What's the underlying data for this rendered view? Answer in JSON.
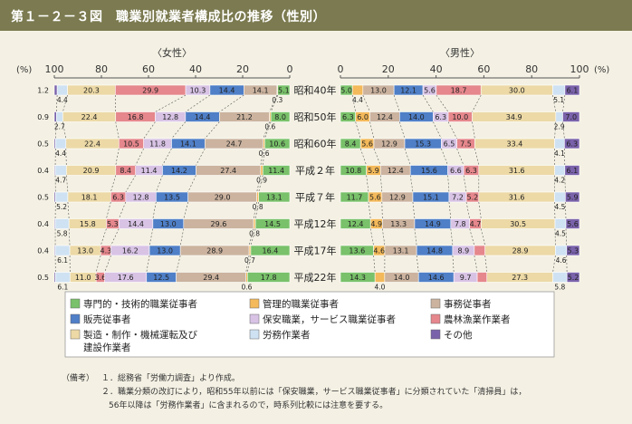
{
  "figure_title": "第１－２－３図　職業別就業者構成比の推移（性別）",
  "notes": {
    "label": "（備考）",
    "lines": [
      "１．総務省「労働力調査」より作成。",
      "２．職業分類の改訂により，昭和55年以前には「保安職業，サービス職業従事者」に分類されていた「清掃員」は，",
      "56年以降は「労務作業者」に含まれるので，時系列比較には注意を要する。"
    ]
  },
  "chart_data": {
    "type": "bar",
    "orientation": "horizontal-stacked-percent",
    "panels": {
      "female": "〈女性〉",
      "male": "〈男性〉"
    },
    "axis_unit": "(%)",
    "female_ticks": [
      "100",
      "80",
      "60",
      "40",
      "20",
      "0"
    ],
    "male_ticks": [
      "0",
      "20",
      "40",
      "60",
      "80",
      "100"
    ],
    "categories": [
      "昭和40年",
      "昭和50年",
      "昭和60年",
      "平成２年",
      "平成７年",
      "平成12年",
      "平成17年",
      "平成22年"
    ],
    "colors": {
      "professional": "#79c16a",
      "managerial": "#f3b95a",
      "clerical": "#cbb39f",
      "sales": "#4f7fc7",
      "service": "#d8c3e5",
      "agriculture": "#e5878c",
      "production": "#ecd9a6",
      "labor": "#cfe2f3",
      "other": "#7a62ab"
    },
    "legend": [
      {
        "key": "professional",
        "label": "専門的・技術的職業従事者"
      },
      {
        "key": "managerial",
        "label": "管理的職業従事者"
      },
      {
        "key": "clerical",
        "label": "事務従事者"
      },
      {
        "key": "sales",
        "label": "販売従事者"
      },
      {
        "key": "service",
        "label": "保安職業，サービス職業従事者"
      },
      {
        "key": "agriculture",
        "label": "農林漁業作業者"
      },
      {
        "key": "production",
        "label": "製造・制作・機械運転及び\n建設作業者"
      },
      {
        "key": "labor",
        "label": "労務作業者"
      },
      {
        "key": "other",
        "label": "その他"
      }
    ],
    "female": [
      {
        "year": "昭和40年",
        "other": 1.2,
        "labor": 4.4,
        "production": 20.3,
        "agriculture": 29.9,
        "service": 10.3,
        "sales": 14.4,
        "clerical": 14.1,
        "managerial": 0.3,
        "professional": 5.1
      },
      {
        "year": "昭和50年",
        "other": 0.9,
        "labor": 2.7,
        "production": 22.4,
        "agriculture": 16.8,
        "service": 12.8,
        "sales": 14.4,
        "clerical": 21.2,
        "managerial": 0.6,
        "professional": 8.0
      },
      {
        "year": "昭和60年",
        "other": 0.5,
        "labor": 4.4,
        "production": 22.4,
        "agriculture": 10.5,
        "service": 11.8,
        "sales": 14.1,
        "clerical": 24.7,
        "managerial": 0.6,
        "professional": 10.6
      },
      {
        "year": "平成２年",
        "other": 0.4,
        "labor": 4.7,
        "production": 20.9,
        "agriculture": 8.4,
        "service": 11.4,
        "sales": 14.2,
        "clerical": 27.4,
        "managerial": 0.9,
        "professional": 11.4
      },
      {
        "year": "平成７年",
        "other": 0.5,
        "labor": 5.2,
        "production": 18.1,
        "agriculture": 6.3,
        "service": 12.8,
        "sales": 13.5,
        "clerical": 29.0,
        "managerial": 0.8,
        "professional": 13.1
      },
      {
        "year": "平成12年",
        "other": 0.4,
        "labor": 5.8,
        "production": 15.8,
        "agriculture": 5.3,
        "service": 14.4,
        "sales": 13.0,
        "clerical": 29.6,
        "managerial": 0.8,
        "professional": 14.5
      },
      {
        "year": "平成17年",
        "other": 0.4,
        "labor": 6.1,
        "production": 13.0,
        "agriculture": 4.3,
        "service": 16.2,
        "sales": 13.0,
        "clerical": 28.9,
        "managerial": 0.7,
        "professional": 16.4
      },
      {
        "year": "平成22年",
        "other": 0.5,
        "labor": 6.1,
        "production": 11.0,
        "agriculture": 3.6,
        "service": 17.6,
        "sales": 12.5,
        "clerical": 29.4,
        "managerial": 0.6,
        "professional": 17.8
      }
    ],
    "male": [
      {
        "year": "昭和40年",
        "professional": 5.0,
        "managerial": 4.4,
        "clerical": 13.0,
        "sales": 12.1,
        "service": 5.6,
        "agriculture": 18.7,
        "production": 30.0,
        "labor": 5.1,
        "other": 6.1
      },
      {
        "year": "昭和50年",
        "professional": 6.3,
        "managerial": 6.0,
        "clerical": 12.4,
        "sales": 14.0,
        "service": 6.3,
        "agriculture": 10.0,
        "production": 34.9,
        "labor": 2.9,
        "other": 7.0
      },
      {
        "year": "昭和60年",
        "professional": 8.4,
        "managerial": 5.6,
        "clerical": 12.9,
        "sales": 15.3,
        "service": 6.5,
        "agriculture": 7.5,
        "production": 33.4,
        "labor": 4.1,
        "other": 6.3
      },
      {
        "year": "平成２年",
        "professional": 10.8,
        "managerial": 5.9,
        "clerical": 12.4,
        "sales": 15.6,
        "service": 6.6,
        "agriculture": 6.3,
        "production": 31.6,
        "labor": 4.2,
        "other": 6.1
      },
      {
        "year": "平成７年",
        "professional": 11.7,
        "managerial": 5.6,
        "clerical": 12.9,
        "sales": 15.1,
        "service": 7.2,
        "agriculture": 5.2,
        "production": 31.6,
        "labor": 4.5,
        "other": 5.9
      },
      {
        "year": "平成12年",
        "professional": 12.4,
        "managerial": 4.9,
        "clerical": 13.3,
        "sales": 14.9,
        "service": 7.8,
        "agriculture": 4.7,
        "production": 30.5,
        "labor": 4.5,
        "other": 5.6
      },
      {
        "year": "平成17年",
        "professional": 13.6,
        "managerial": 4.6,
        "clerical": 13.1,
        "sales": 14.8,
        "service": 8.9,
        "agriculture": 4.4,
        "production": 28.9,
        "labor": 4.6,
        "other": 5.3
      },
      {
        "year": "平成22年",
        "professional": 14.3,
        "managerial": 4.0,
        "clerical": 14.0,
        "sales": 14.6,
        "service": 9.7,
        "agriculture": 4.0,
        "production": 27.3,
        "labor": 5.8,
        "other": 5.2
      }
    ],
    "female_order": [
      "other",
      "labor",
      "production",
      "agriculture",
      "service",
      "sales",
      "clerical",
      "managerial",
      "professional"
    ],
    "male_order": [
      "professional",
      "managerial",
      "clerical",
      "sales",
      "service",
      "agriculture",
      "production",
      "labor",
      "other"
    ],
    "female_inline": [
      "production",
      "agriculture",
      "service",
      "sales",
      "clerical",
      "professional"
    ],
    "female_below": [
      "labor",
      "managerial"
    ],
    "female_left": [
      "other"
    ],
    "male_inline": [
      "professional",
      "managerial",
      "clerical",
      "sales",
      "service",
      "agriculture",
      "production",
      "other"
    ],
    "male_below": [
      "managerial",
      "labor"
    ]
  }
}
